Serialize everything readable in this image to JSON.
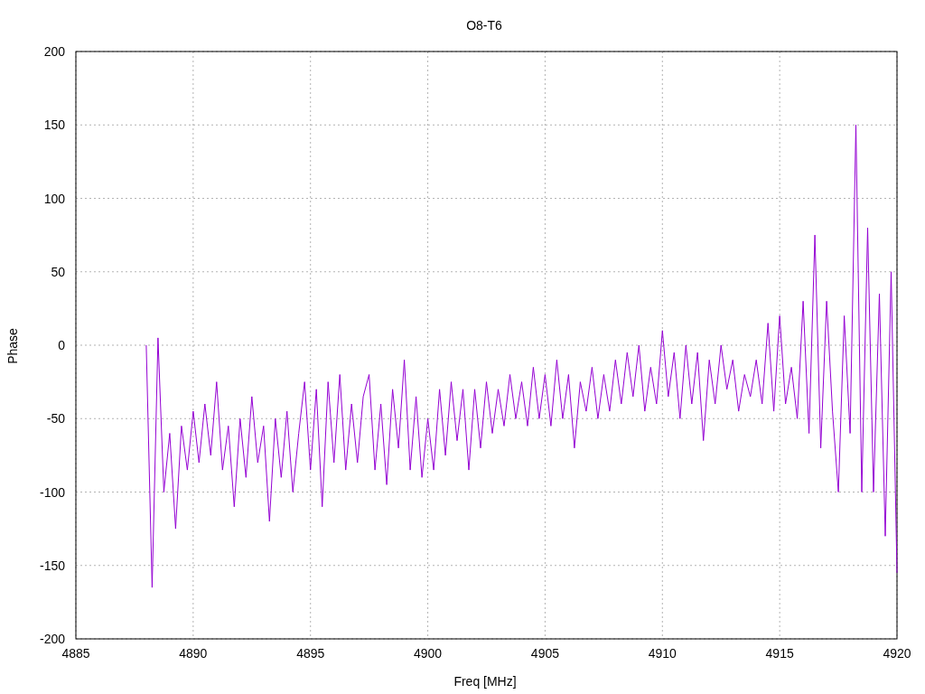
{
  "chart": {
    "chart_data": {
      "type": "line",
      "grid": true,
      "title": "O8-T6",
      "xlabel": "Freq [MHz]",
      "ylabel": "Phase",
      "xlim": [
        4885,
        4920
      ],
      "ylim": [
        -200,
        200
      ],
      "xticks": [
        4885,
        4890,
        4895,
        4900,
        4905,
        4910,
        4915,
        4920
      ],
      "yticks": [
        -200,
        -150,
        -100,
        -50,
        0,
        50,
        100,
        150,
        200
      ],
      "x": [
        4888,
        4888.25,
        4888.5,
        4888.75,
        4889,
        4889.25,
        4889.5,
        4889.75,
        4890,
        4890.25,
        4890.5,
        4890.75,
        4891,
        4891.25,
        4891.5,
        4891.75,
        4892,
        4892.25,
        4892.5,
        4892.75,
        4893,
        4893.25,
        4893.5,
        4893.75,
        4894,
        4894.25,
        4894.5,
        4894.75,
        4895,
        4895.25,
        4895.5,
        4895.75,
        4896,
        4896.25,
        4896.5,
        4896.75,
        4897,
        4897.25,
        4897.5,
        4897.75,
        4898,
        4898.25,
        4898.5,
        4898.75,
        4899,
        4899.25,
        4899.5,
        4899.75,
        4900,
        4900.25,
        4900.5,
        4900.75,
        4901,
        4901.25,
        4901.5,
        4901.75,
        4902,
        4902.25,
        4902.5,
        4902.75,
        4903,
        4903.25,
        4903.5,
        4903.75,
        4904,
        4904.25,
        4904.5,
        4904.75,
        4905,
        4905.25,
        4905.5,
        4905.75,
        4906,
        4906.25,
        4906.5,
        4906.75,
        4907,
        4907.25,
        4907.5,
        4907.75,
        4908,
        4908.25,
        4908.5,
        4908.75,
        4909,
        4909.25,
        4909.5,
        4909.75,
        4910,
        4910.25,
        4910.5,
        4910.75,
        4911,
        4911.25,
        4911.5,
        4911.75,
        4912,
        4912.25,
        4912.5,
        4912.75,
        4913,
        4913.25,
        4913.5,
        4913.75,
        4914,
        4914.25,
        4914.5,
        4914.75,
        4915,
        4915.25,
        4915.5,
        4915.75,
        4916,
        4916.25,
        4916.5,
        4916.75,
        4917,
        4917.25,
        4917.5,
        4917.75,
        4918,
        4918.25,
        4918.5,
        4918.75,
        4919,
        4919.25,
        4919.5,
        4919.75,
        4920
      ],
      "series": [
        {
          "color": "#9400d3",
          "values": [
            0,
            -165,
            5,
            -100,
            -60,
            -125,
            -55,
            -85,
            -45,
            -80,
            -40,
            -75,
            -25,
            -85,
            -55,
            -110,
            -50,
            -90,
            -35,
            -80,
            -55,
            -120,
            -50,
            -90,
            -45,
            -100,
            -60,
            -25,
            -85,
            -30,
            -110,
            -25,
            -80,
            -20,
            -85,
            -40,
            -80,
            -35,
            -20,
            -85,
            -40,
            -95,
            -30,
            -70,
            -10,
            -85,
            -35,
            -90,
            -50,
            -85,
            -30,
            -75,
            -25,
            -65,
            -30,
            -85,
            -30,
            -70,
            -25,
            -60,
            -30,
            -55,
            -20,
            -50,
            -25,
            -55,
            -15,
            -50,
            -20,
            -55,
            -10,
            -50,
            -20,
            -70,
            -25,
            -45,
            -15,
            -50,
            -20,
            -45,
            -10,
            -40,
            -5,
            -35,
            0,
            -45,
            -15,
            -40,
            10,
            -35,
            -5,
            -50,
            0,
            -40,
            -5,
            -65,
            -10,
            -40,
            0,
            -30,
            -10,
            -45,
            -20,
            -35,
            -10,
            -40,
            15,
            -45,
            20,
            -40,
            -15,
            -50,
            30,
            -60,
            75,
            -70,
            30,
            -45,
            -100,
            20,
            -60,
            150,
            -100,
            80,
            -100,
            35,
            -130,
            50,
            -155
          ]
        }
      ]
    }
  }
}
